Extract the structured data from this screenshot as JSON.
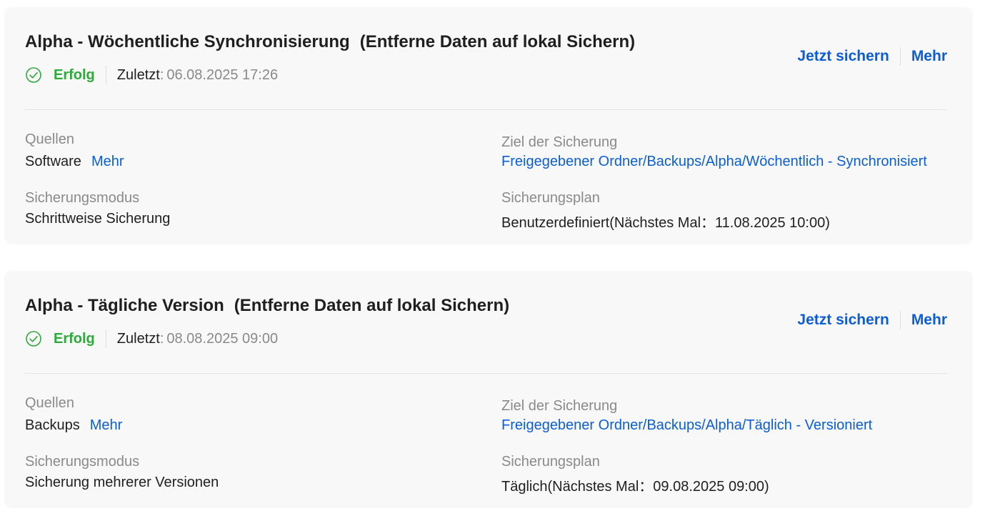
{
  "jobs": [
    {
      "name": "Alpha - Wöchentliche Synchronisierung",
      "mode": "(Entferne Daten auf lokal Sichern)",
      "status": "Erfolg",
      "last_label": "Zuletzt",
      "last_colon": ":",
      "last_value": "06.08.2025 17:26",
      "actions": {
        "backup_now": "Jetzt sichern",
        "more": "Mehr"
      },
      "sources_label": "Quellen",
      "sources_value": "Software",
      "sources_more": "Mehr",
      "destination_label": "Ziel der Sicherung",
      "destination_value": "Freigegebener Ordner/Backups/Alpha/Wöchentlich - Synchronisiert",
      "backup_mode_label": "Sicherungsmodus",
      "backup_mode_value": "Schrittweise Sicherung",
      "schedule_label": "Sicherungsplan",
      "schedule_value": "Benutzerdefiniert(Nächstes Mal：11.08.2025 10:00)"
    },
    {
      "name": "Alpha - Tägliche Version",
      "mode": "(Entferne Daten auf lokal Sichern)",
      "status": "Erfolg",
      "last_label": "Zuletzt",
      "last_colon": ":",
      "last_value": "08.08.2025 09:00",
      "actions": {
        "backup_now": "Jetzt sichern",
        "more": "Mehr"
      },
      "sources_label": "Quellen",
      "sources_value": "Backups",
      "sources_more": "Mehr",
      "destination_label": "Ziel der Sicherung",
      "destination_value": "Freigegebener Ordner/Backups/Alpha/Täglich - Versioniert",
      "backup_mode_label": "Sicherungsmodus",
      "backup_mode_value": "Sicherung mehrerer Versionen",
      "schedule_label": "Sicherungsplan",
      "schedule_value": "Täglich(Nächstes Mal：09.08.2025 09:00)"
    }
  ],
  "icons": {
    "status": "check-circle-icon"
  },
  "colors": {
    "success": "#2eaa3a",
    "link": "#0b5ed7",
    "muted": "#8a8a8a",
    "card_bg": "#f8f8f8"
  }
}
